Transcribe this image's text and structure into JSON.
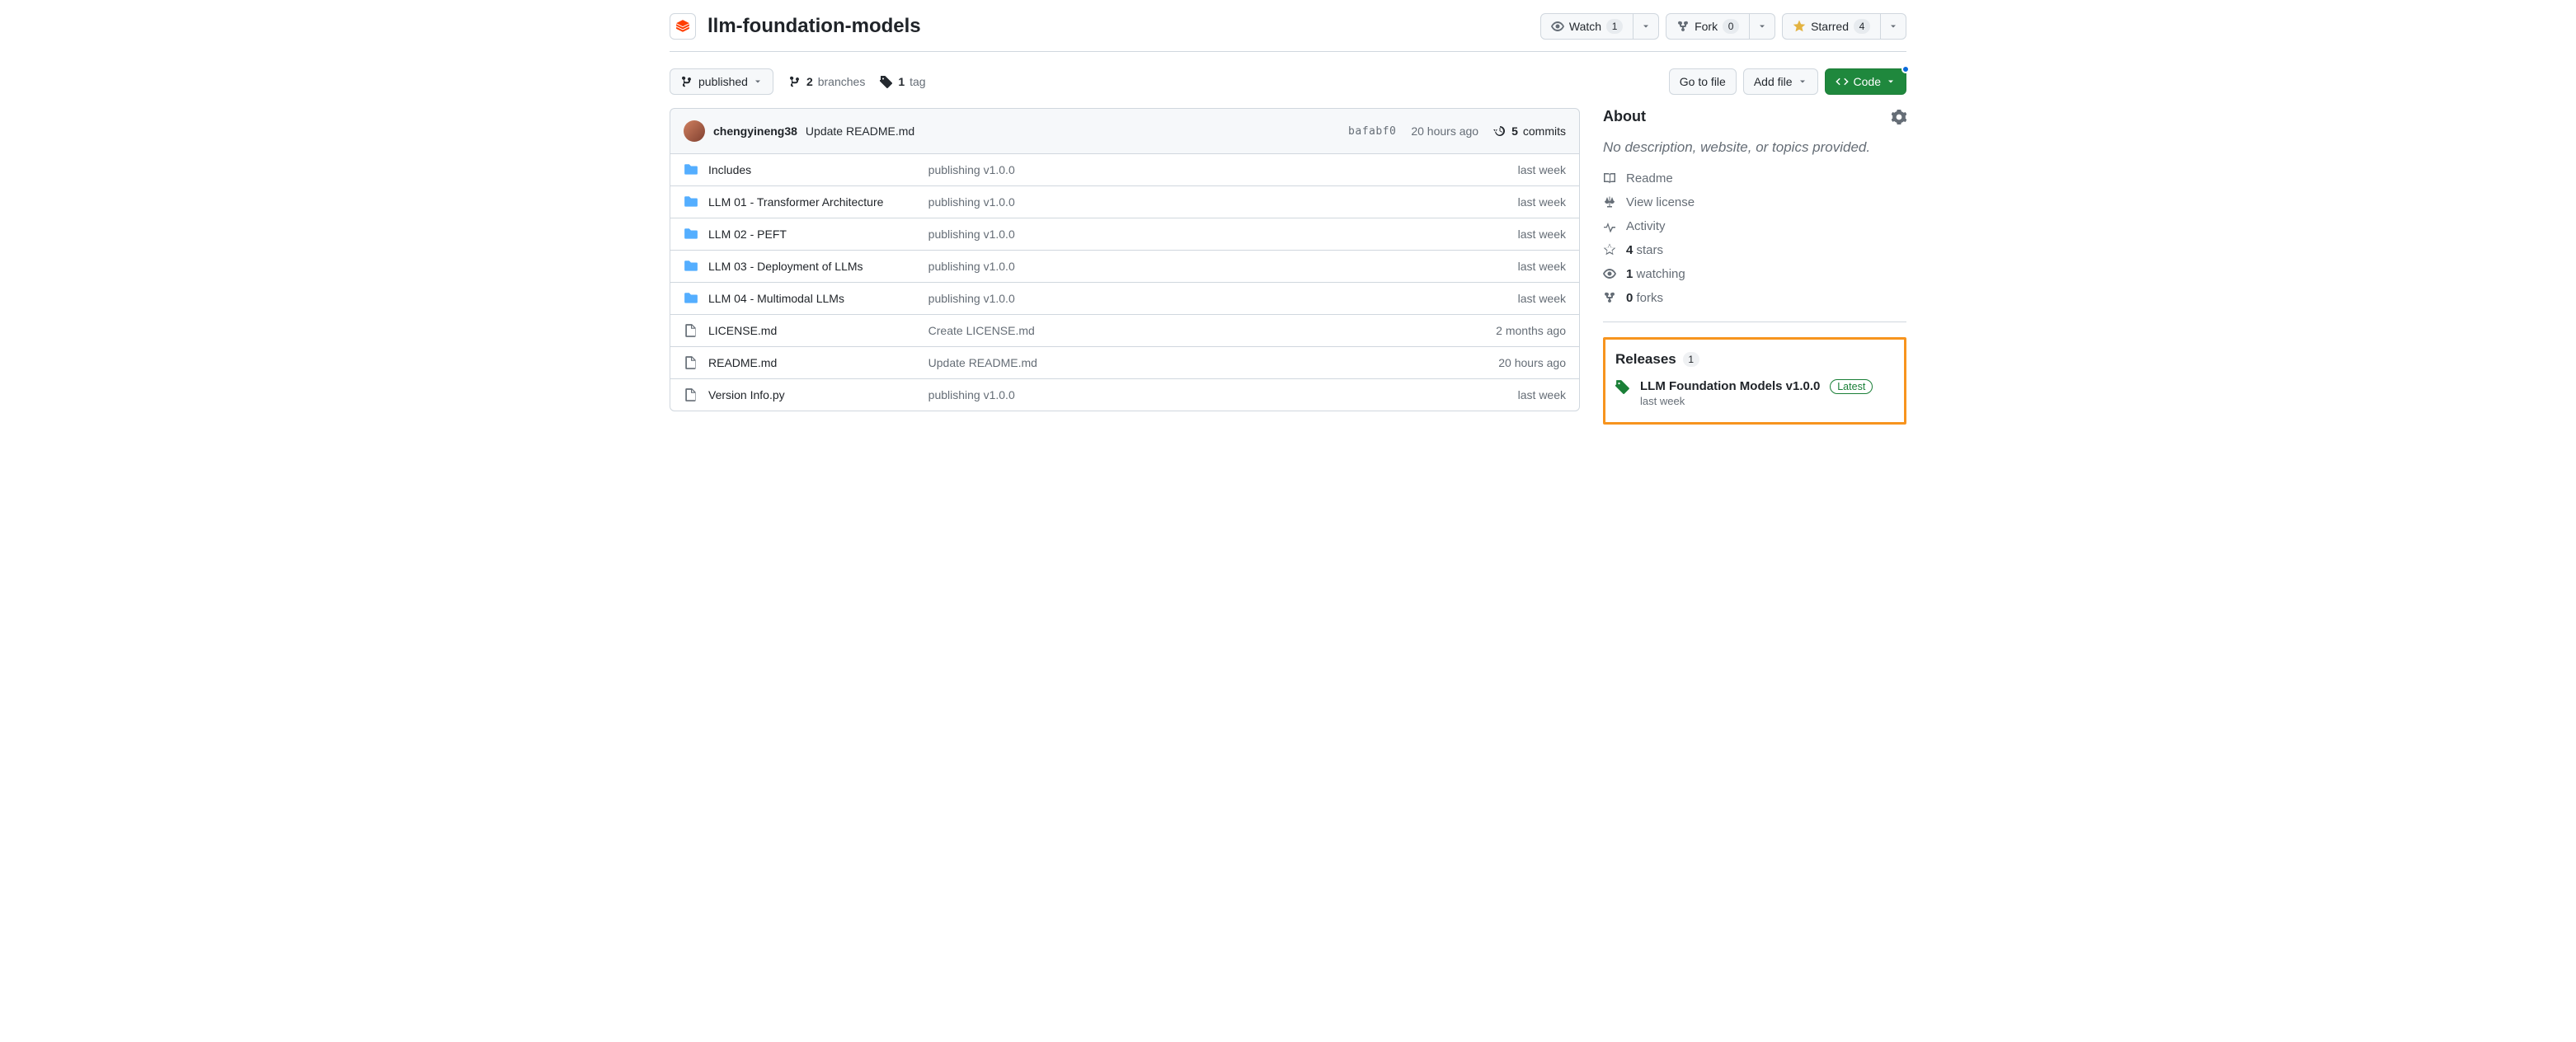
{
  "repo": {
    "name": "llm-foundation-models"
  },
  "actions": {
    "watch": {
      "label": "Watch",
      "count": "1"
    },
    "fork": {
      "label": "Fork",
      "count": "0"
    },
    "star": {
      "label": "Starred",
      "count": "4"
    }
  },
  "toolbar": {
    "branch_label": "published",
    "branches_count": "2",
    "branches_word": "branches",
    "tags_count": "1",
    "tags_word": "tag",
    "goto_file": "Go to file",
    "add_file": "Add file",
    "code": "Code"
  },
  "commit": {
    "author": "chengyineng38",
    "message": "Update README.md",
    "sha": "bafabf0",
    "time": "20 hours ago",
    "count": "5",
    "count_word": "commits"
  },
  "files": [
    {
      "type": "dir",
      "name": "Includes",
      "msg": "publishing v1.0.0",
      "date": "last week"
    },
    {
      "type": "dir",
      "name": "LLM 01 - Transformer Architecture",
      "msg": "publishing v1.0.0",
      "date": "last week"
    },
    {
      "type": "dir",
      "name": "LLM 02 - PEFT",
      "msg": "publishing v1.0.0",
      "date": "last week"
    },
    {
      "type": "dir",
      "name": "LLM 03 - Deployment of LLMs",
      "msg": "publishing v1.0.0",
      "date": "last week"
    },
    {
      "type": "dir",
      "name": "LLM 04 - Multimodal LLMs",
      "msg": "publishing v1.0.0",
      "date": "last week"
    },
    {
      "type": "file",
      "name": "LICENSE.md",
      "msg": "Create LICENSE.md",
      "date": "2 months ago"
    },
    {
      "type": "file",
      "name": "README.md",
      "msg": "Update README.md",
      "date": "20 hours ago"
    },
    {
      "type": "file",
      "name": "Version Info.py",
      "msg": "publishing v1.0.0",
      "date": "last week"
    }
  ],
  "sidebar": {
    "about_title": "About",
    "about_desc": "No description, website, or topics provided.",
    "links": {
      "readme": "Readme",
      "license": "View license",
      "activity": "Activity",
      "stars_count": "4",
      "stars_word": "stars",
      "watching_count": "1",
      "watching_word": "watching",
      "forks_count": "0",
      "forks_word": "forks"
    },
    "releases": {
      "title": "Releases",
      "count": "1",
      "name": "LLM Foundation Models v1.0.0",
      "badge": "Latest",
      "date": "last week"
    }
  }
}
